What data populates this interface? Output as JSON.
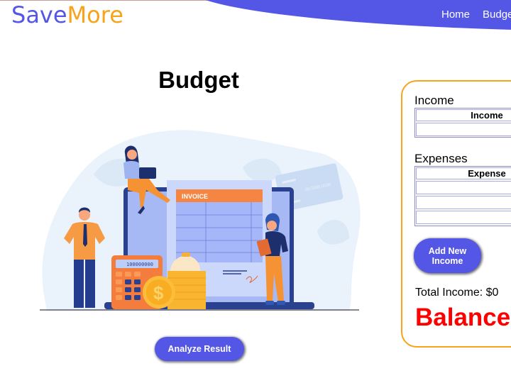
{
  "header": {
    "logo_part1": "Save",
    "logo_part2": "More",
    "nav": [
      {
        "label": "Home"
      },
      {
        "label": "Budget"
      }
    ]
  },
  "main": {
    "title": "Budget",
    "illustration": {
      "invoice_label": "INVOICE",
      "calculator_display": "100000000",
      "card_number": "00 0000 0000",
      "coin_symbol": "$"
    },
    "analyze_button": "Analyze Result"
  },
  "panel": {
    "income": {
      "title": "Income",
      "column_header": "Income",
      "rows": [
        ""
      ]
    },
    "expenses": {
      "title": "Expenses",
      "column_header": "Expense",
      "rows": [
        "",
        "",
        ""
      ]
    },
    "add_income_button": "Add New Income",
    "total_income": "Total Income: $0",
    "balance": "Balance"
  },
  "colors": {
    "brand_blue": "#5457e6",
    "brand_orange": "#f7a31c",
    "balance_red": "#ff0000"
  }
}
